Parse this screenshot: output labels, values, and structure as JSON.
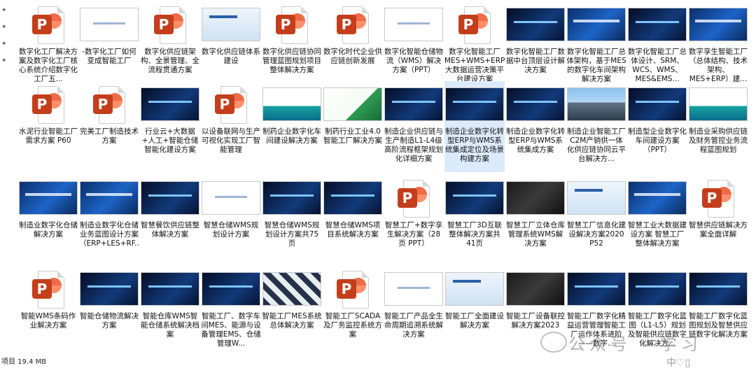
{
  "status_bar": {
    "text": "项目 19.4 MB"
  },
  "watermark": {
    "text": "公众号 · 学习",
    "corner_text": "中♡▯"
  },
  "files": [
    {
      "label": "数字化工厂解决方案及数字化工厂核心系统介绍数字化工厂五...",
      "thumb": "ppt"
    },
    {
      "label": "-数字化工厂如何变成智能工厂",
      "thumb": "white"
    },
    {
      "label": "数字化供应链架构、全景管理、全流程贯通方案",
      "thumb": "ppt"
    },
    {
      "label": "数字化供应链体系建设",
      "thumb": "light"
    },
    {
      "label": "数字化供应链协同管理蓝图规划项目整体解决方案",
      "thumb": "ppt"
    },
    {
      "label": "数字化时代企业供应链创新发展",
      "thumb": "ppt"
    },
    {
      "label": "数字化智能仓储物流（WMS）解决方案（PPT）",
      "thumb": "white"
    },
    {
      "label": "数字化智能工厂MES+WMS+ERP大数据运营决策平台建设方案",
      "thumb": "ppt"
    },
    {
      "label": "数字化智能工厂数据中台顶层设计解决方案",
      "thumb": "dark"
    },
    {
      "label": "数字化智能工厂总体架构，基于MES的数字化车间架构解决方案",
      "thumb": "blue"
    },
    {
      "label": "数字化智能工厂总体设计、SRM、WCS、WMS、MES&EMS...",
      "thumb": "dark"
    },
    {
      "label": "数字孪生智能工厂（总体结构、技术架构、MES+ERP）建...",
      "thumb": "blue"
    },
    {
      "label": "水泥行业智能工厂需求方案 P60",
      "thumb": "ppt"
    },
    {
      "label": "完美工厂制造技术方案",
      "thumb": "ppt"
    },
    {
      "label": "行业云+大数据+人工+智能仓储智能化建设方案",
      "thumb": "dark"
    },
    {
      "label": "以设备联网与生产可视化实现工厂智能管理",
      "thumb": "ppt"
    },
    {
      "label": "制药企业数字化车间建设解决方案",
      "thumb": "teal"
    },
    {
      "label": "制药行业工业4.0智能工厂解决方案",
      "thumb": "green"
    },
    {
      "label": "制造企业供应链与生产制造L1-L4级高阶流程框架规划化详细方案",
      "thumb": "dark"
    },
    {
      "label": "制造企业数字化转型ERP与WMS系统集成定位及场景构建方案",
      "thumb": "dark",
      "selected": true
    },
    {
      "label": "制造企业数字化转型ERP与WMS系统集成方案",
      "thumb": "dark"
    },
    {
      "label": "制造企业智能工厂C2M产销供一体化供应链协同云平台解决方...",
      "thumb": "city"
    },
    {
      "label": "制造型企业数字化车间建设方案（PPT）",
      "thumb": "dark"
    },
    {
      "label": "制造业采购供应链及财务管控业务流程蓝图规划",
      "thumb": "teal"
    },
    {
      "label": "制造业数字化仓储解决方案",
      "thumb": "blue"
    },
    {
      "label": "制造业数字化仓储业务蓝图设计方案（ERP+LES+RF...",
      "thumb": "blue"
    },
    {
      "label": "智慧餐饮供应链整体解决方案",
      "thumb": "dark"
    },
    {
      "label": "智慧仓储WMS规划设计方案",
      "thumb": "white"
    },
    {
      "label": "智慧仓储WMS规划设计方案共75页",
      "thumb": "dark"
    },
    {
      "label": "智慧仓储WMS项目系统解决方案",
      "thumb": "dark"
    },
    {
      "label": "智慧工厂+数字孪生解决方案（28页 PPT）",
      "thumb": "ppt"
    },
    {
      "label": "智慧工厂3D互联整体解决方案共41页",
      "thumb": "dark"
    },
    {
      "label": "智慧工厂立体仓库管理系统WMS解决方案",
      "thumb": "gray"
    },
    {
      "label": "智慧工厂信息化建设解决方案2020 P52",
      "thumb": "light"
    },
    {
      "label": "智慧工业大数据建设方案 智慧工厂整体解决方案",
      "thumb": "blue"
    },
    {
      "label": "智慧供应链解决方案全面详解",
      "thumb": "ppt"
    },
    {
      "label": "智能WMS条码作业解决方案",
      "thumb": "ppt"
    },
    {
      "label": "智能仓储物流解决方案",
      "thumb": "dark"
    },
    {
      "label": "智能仓库WMS智能仓储系统解决档案",
      "thumb": "dark"
    },
    {
      "label": "智能工厂、数字车间MES、能源与设备管理EMS、仓储管理W...",
      "thumb": "dark"
    },
    {
      "label": "智能工厂MES系统总体解决方案",
      "thumb": "pattern"
    },
    {
      "label": "智能工厂SCADA及厂务监控系统方案",
      "thumb": "ppt"
    },
    {
      "label": "智能工厂产品全生命周期追溯系统解决方案",
      "thumb": "white"
    },
    {
      "label": "智能工厂全面建设解决方案",
      "thumb": "light"
    },
    {
      "label": "智能工厂设备联控解决方案2023",
      "thumb": "gray"
    },
    {
      "label": "智能工厂数字化精益运营管理智能工厂运作体系进阶——数字...",
      "thumb": "dark"
    },
    {
      "label": "智能工厂数字化蓝图（L1-L5）规划及智能供应链数字化解决方...",
      "thumb": "dark"
    },
    {
      "label": "智能工厂数字化蓝图规划及智慧供应链数字化解决方案",
      "thumb": "dark"
    }
  ]
}
